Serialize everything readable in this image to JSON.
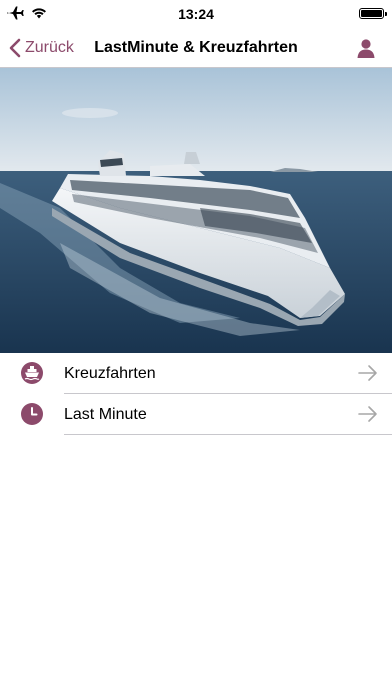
{
  "status_bar": {
    "time": "13:24",
    "icons": [
      "airplane-icon",
      "wifi-icon",
      "battery-icon"
    ]
  },
  "nav": {
    "back_label": "Zurück",
    "title": "LastMinute & Kreuzfahrten",
    "profile_icon": "person-icon"
  },
  "hero": {
    "icon": "cruise-ship-photo"
  },
  "menu": [
    {
      "label": "Kreuzfahrten",
      "icon": "ship-icon"
    },
    {
      "label": "Last Minute",
      "icon": "clock-icon"
    }
  ],
  "colors": {
    "accent": "#8c4a6b",
    "separator": "#c8c7cc",
    "arrow": "#a7a7a7"
  }
}
